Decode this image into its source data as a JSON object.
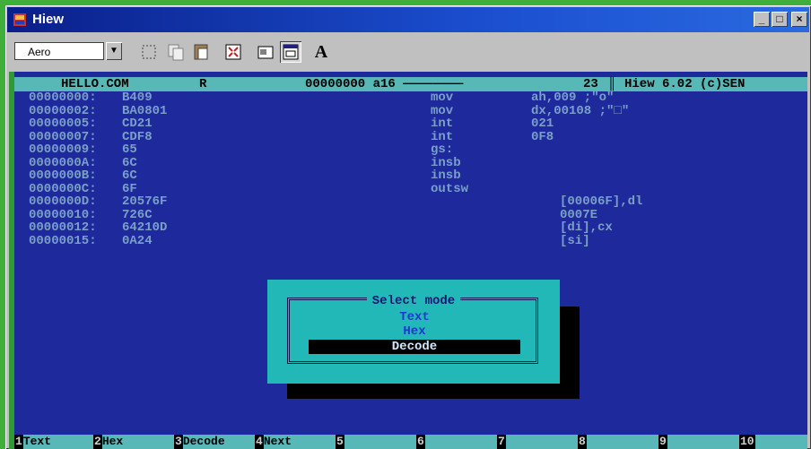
{
  "window": {
    "title": "Hiew",
    "controls": {
      "minimize": "_",
      "maximize": "□",
      "close": "×"
    }
  },
  "toolbar": {
    "font_value": "Aero",
    "icons": [
      "select-icon",
      "copy-icon",
      "paste-icon",
      "fullscreen-icon",
      "properties-icon",
      "background-icon",
      "font-icon"
    ],
    "font_button_label": "A"
  },
  "status": {
    "filename": "HELLO.COM",
    "mode_flag": "R",
    "offset": "00000000 a16 ————————",
    "position": "23",
    "version": "Hiew 6.02 (c)SEN"
  },
  "dump": [
    {
      "addr": "00000000:",
      "hex": "B409",
      "mn": "mov",
      "op": "ah,009 ;\"o\""
    },
    {
      "addr": "00000002:",
      "hex": "BA0801",
      "mn": "mov",
      "op": "dx,00108 ;\"□\""
    },
    {
      "addr": "00000005:",
      "hex": "CD21",
      "mn": "int",
      "op": "021"
    },
    {
      "addr": "00000007:",
      "hex": "CDF8",
      "mn": "int",
      "op": "0F8"
    },
    {
      "addr": "00000009:",
      "hex": "65",
      "mn": "gs:",
      "op": ""
    },
    {
      "addr": "0000000A:",
      "hex": "6C",
      "mn": "insb",
      "op": ""
    },
    {
      "addr": "0000000B:",
      "hex": "6C",
      "mn": "insb",
      "op": ""
    },
    {
      "addr": "0000000C:",
      "hex": "6F",
      "mn": "outsw",
      "op": ""
    },
    {
      "addr": "0000000D:",
      "hex": "20576F",
      "mn": "",
      "op": "",
      "tail": "[00006F],dl"
    },
    {
      "addr": "00000010:",
      "hex": "726C",
      "mn": "",
      "op": "",
      "tail": "0007E"
    },
    {
      "addr": "00000012:",
      "hex": "64210D",
      "mn": "",
      "op": "",
      "tail": "[di],cx"
    },
    {
      "addr": "00000015:",
      "hex": "0A24",
      "mn": "",
      "op": "",
      "tail": "[si]"
    }
  ],
  "dialog": {
    "title": "Select mode",
    "options": [
      "Text",
      "Hex",
      "Decode"
    ],
    "selected": "Decode"
  },
  "fkeys": [
    {
      "num": "1",
      "label": "Text"
    },
    {
      "num": "2",
      "label": "Hex"
    },
    {
      "num": "3",
      "label": "Decode"
    },
    {
      "num": "4",
      "label": "Next"
    },
    {
      "num": "5",
      "label": ""
    },
    {
      "num": "6",
      "label": ""
    },
    {
      "num": "7",
      "label": ""
    },
    {
      "num": "8",
      "label": ""
    },
    {
      "num": "9",
      "label": ""
    },
    {
      "num": "10",
      "label": ""
    }
  ]
}
